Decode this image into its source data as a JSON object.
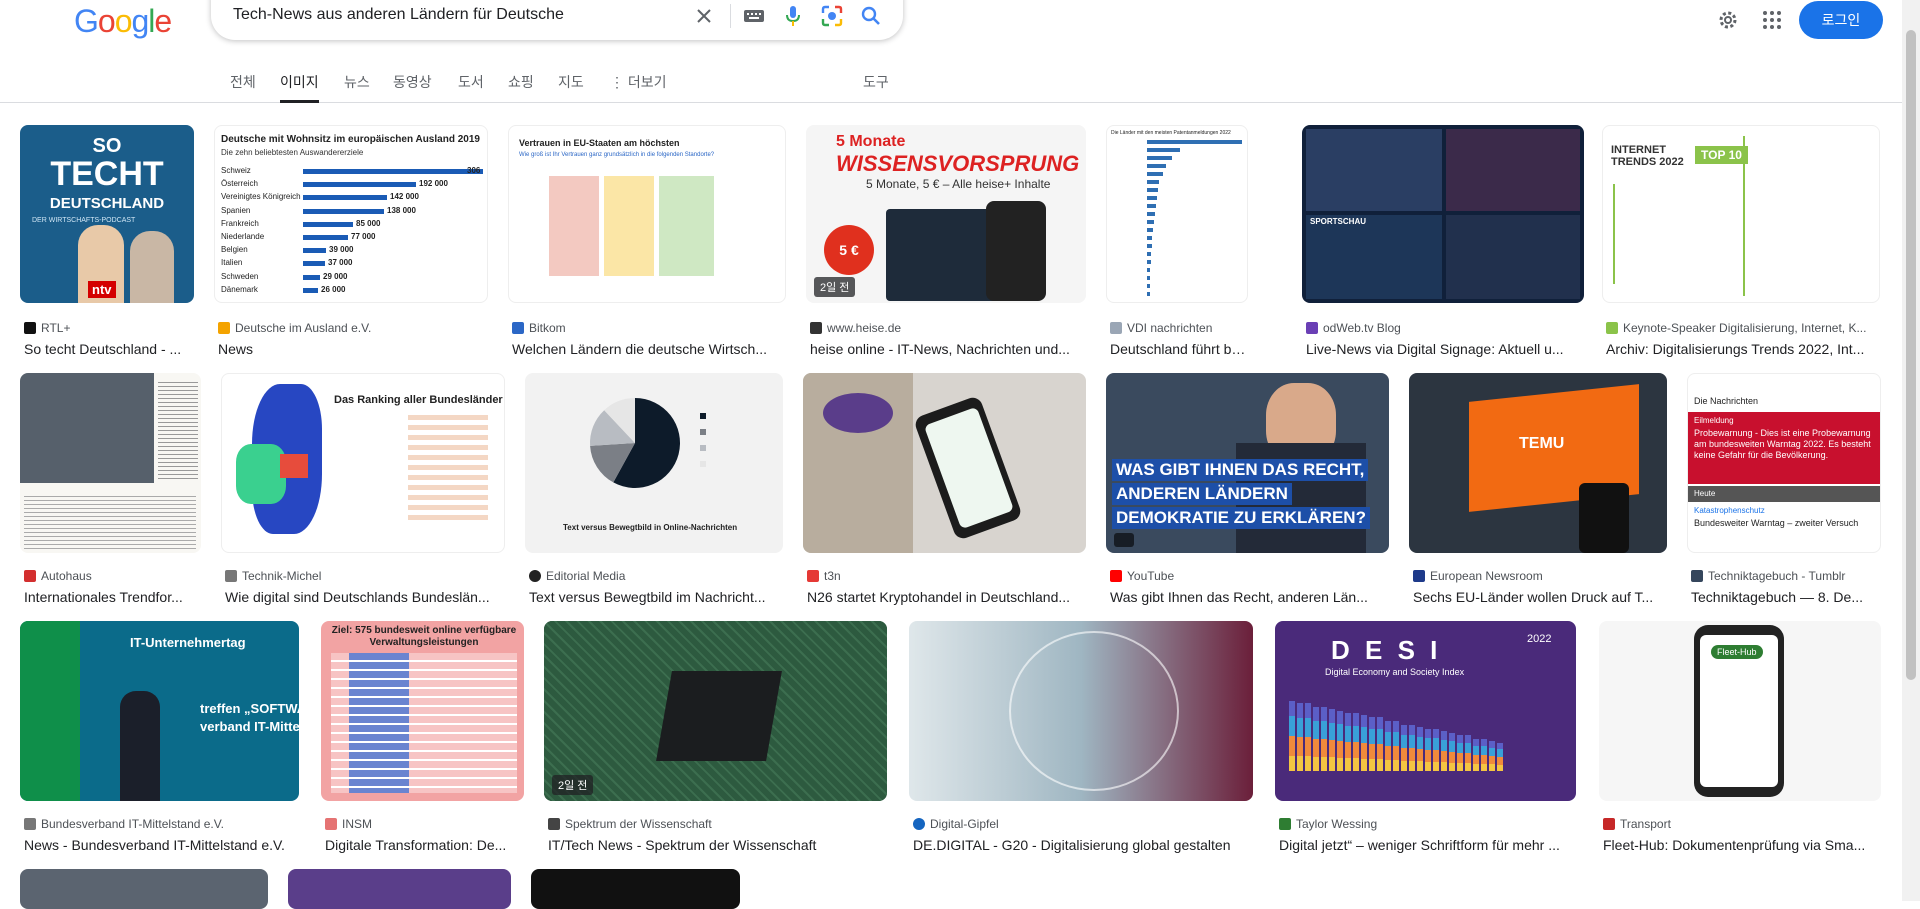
{
  "header": {
    "logo": [
      "G",
      "o",
      "o",
      "g",
      "l",
      "e"
    ],
    "logo_colors": [
      "#4285f4",
      "#ea4335",
      "#fbbc05",
      "#4285f4",
      "#34a853",
      "#ea4335"
    ],
    "search_value": "Tech-News aus anderen Ländern für Deutsche",
    "login_label": "로그인",
    "icons": [
      "close-icon",
      "keyboard-icon",
      "microphone-icon",
      "lens-icon",
      "search-icon",
      "gear-icon",
      "apps-icon"
    ]
  },
  "tabs": [
    "전체",
    "이미지",
    "뉴스",
    "동영상",
    "도서",
    "쇼핑",
    "지도",
    "⋮ 더보기",
    "도구"
  ],
  "active_tab": "이미지",
  "results": [
    {
      "source": "RTL+",
      "title": "So techt Deutschland - ...",
      "fav": "#111111",
      "thumb": {
        "line1": "SO",
        "line2": "TECHT",
        "line3": "DEUTSCHLAND",
        "sub": "DER WIRTSCHAFTS-PODCAST",
        "logo": "ntv"
      }
    },
    {
      "source": "Deutsche im Ausland e.V.",
      "title": "News",
      "fav": "#f4a300",
      "thumb": {
        "heading": "Deutsche mit Wohnsitz im europäischen Ausland 2019",
        "sub": "Die zehn beliebtesten Auswandererziele",
        "countries": [
          "Schweiz",
          "Österreich",
          "Vereinigtes Königreich",
          "Spanien",
          "Frankreich",
          "Niederlande",
          "Belgien",
          "Italien",
          "Schweden",
          "Dänemark"
        ],
        "values": [
          "306",
          "192 000",
          "142 000",
          "138 000",
          "85 000",
          "77 000",
          "39 000",
          "37 000",
          "29 000",
          "26 000"
        ],
        "bar_fractions": [
          1.0,
          0.627,
          0.464,
          0.451,
          0.278,
          0.252,
          0.127,
          0.121,
          0.095,
          0.085
        ]
      }
    },
    {
      "source": "Bitkom",
      "title": "Welchen Ländern die deutsche Wirtsch...",
      "fav": "#2b67c6",
      "thumb": {
        "heading": "Vertrauen in EU-Staaten am höchsten",
        "sub": "Wie groß ist Ihr Vertrauen ganz grundsätzlich in die folgenden Standorte?"
      }
    },
    {
      "source": "www.heise.de",
      "title": "heise online - IT-News, Nachrichten und...",
      "fav": "#333333",
      "badge": "2일 전",
      "thumb": {
        "line1": "5 Monate",
        "line2": "WISSENSVORSPRUNG",
        "line3": "5 Monate, 5 € – Alle heise+ Inhalte",
        "circle": "5 €"
      }
    },
    {
      "source": "VDI nachrichten",
      "title": "Deutschland führt bei P...",
      "fav": "#9aa6b5",
      "thumb": {
        "heading": "Die Länder mit den meisten Patentanmeldungen 2022"
      }
    },
    {
      "source": "odWeb.tv Blog",
      "title": "Live-News via Digital Signage: Aktuell u...",
      "fav": "#6a3fb5",
      "thumb": {
        "text": "SPORTSCHAU"
      }
    },
    {
      "source": "Keynote-Speaker Digitalisierung, Internet, K...",
      "title": "Archiv: Digitalisierungs Trends 2022, Int...",
      "fav": "#8bc34a",
      "thumb": {
        "line1": "INTERNET",
        "line2": "TRENDS 2022",
        "badge": "TOP 10"
      }
    },
    {
      "source": "Autohaus",
      "title": "Internationales Trendfor...",
      "fav": "#d32f2f",
      "thumb": {}
    },
    {
      "source": "Technik-Michel",
      "title": "Wie digital sind Deutschlands Bundeslän...",
      "fav": "#777777",
      "thumb": {
        "heading": "Das Ranking aller Bundesländer"
      }
    },
    {
      "source": "Editorial Media",
      "title": "Text versus Bewegtbild im Nachricht...",
      "fav": "#222222",
      "thumb": {
        "heading": "Text versus Bewegtbild in Online-Nachrichten",
        "pie": [
          0.58,
          0.16,
          0.14,
          0.12
        ]
      }
    },
    {
      "source": "t3n",
      "title": "N26 startet Kryptohandel in Deutschland...",
      "fav": "#e53935",
      "thumb": {}
    },
    {
      "source": "YouTube",
      "title": "Was gibt Ihnen das Recht, anderen Län...",
      "fav": "#ff0000",
      "thumb": {
        "line1": "WAS GIBT IHNEN DAS RECHT,",
        "line2": "ANDEREN LÄNDERN",
        "line3": "DEMOKRATIE ZU ERKLÄREN?"
      }
    },
    {
      "source": "European Newsroom",
      "title": "Sechs EU-Länder wollen Druck auf T...",
      "fav": "#1e3a8a",
      "thumb": {
        "logo": "TEMU"
      }
    },
    {
      "source": "Techniktagebuch - Tumblr",
      "title": "Techniktagebuch — 8. De...",
      "fav": "#35465c",
      "thumb": {
        "app": "Die Nachrichten",
        "label": "Eilmeldung",
        "alert": "Probewarnung - Dies ist eine Probewarnung am bundesweiten Warntag 2022. Es besteht keine Gefahr für die Bevölkerung.",
        "section": "Heute",
        "item_src": "Katastrophenschutz",
        "item": "Bundesweiter Warntag – zweiter Versuch"
      }
    },
    {
      "source": "Bundesverband IT-Mittelstand e.V.",
      "title": "News - Bundesverband IT-Mittelstand e.V.",
      "fav": "#777777",
      "thumb": {
        "line1": "IT-Unternehmertag",
        "line2": "treffen „SOFTWARE",
        "line3": "verband IT-Mittels"
      }
    },
    {
      "source": "INSM",
      "title": "Digitale Transformation: De...",
      "fav": "#e57373",
      "thumb": {
        "heading": "Ziel: 575 bundesweit online verfügbare Verwaltungsleistungen"
      }
    },
    {
      "source": "Spektrum der Wissenschaft",
      "title": "IT/Tech News - Spektrum der Wissenschaft",
      "fav": "#444444",
      "badge": "2일 전",
      "thumb": {}
    },
    {
      "source": "Digital-Gipfel",
      "title": "DE.DIGITAL - G20 - Digitalisierung global gestalten",
      "fav": "#1565c0",
      "thumb": {}
    },
    {
      "source": "Taylor Wessing",
      "title": "Digital jetzt“ – weniger Schriftform für mehr ...",
      "fav": "#2e7d32",
      "thumb": {
        "line1": "D E S I",
        "line2": "Digital Economy and Society Index",
        "side": "2022"
      }
    },
    {
      "source": "Transport",
      "title": "Fleet-Hub: Dokumentenprüfung via Sma...",
      "fav": "#c62828",
      "thumb": {
        "logo": "Fleet-Hub"
      }
    }
  ]
}
